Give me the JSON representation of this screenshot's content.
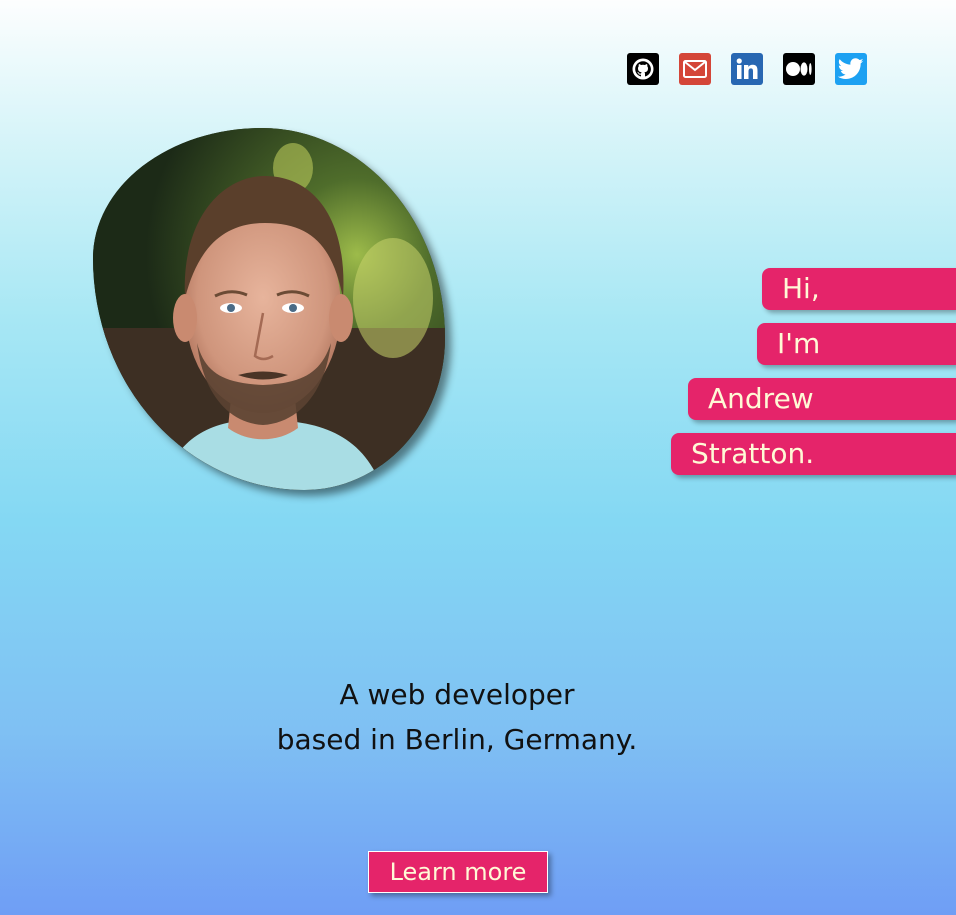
{
  "socials": [
    {
      "name": "GitHub",
      "icon": "github-icon",
      "color": "#000000"
    },
    {
      "name": "Email",
      "icon": "mail-icon",
      "color": "#d44638"
    },
    {
      "name": "LinkedIn",
      "icon": "linkedin-icon",
      "color": "#2867b2"
    },
    {
      "name": "Medium",
      "icon": "medium-icon",
      "color": "#000000"
    },
    {
      "name": "Twitter",
      "icon": "twitter-icon",
      "color": "#1da1f2"
    }
  ],
  "hero": {
    "greeting": [
      "Hi,",
      "I'm",
      "Andrew",
      "Stratton."
    ],
    "tagline_line1": "A web developer",
    "tagline_line2": "based in Berlin, Germany.",
    "cta_label": "Learn more"
  },
  "colors": {
    "accent": "#e5246a",
    "accent_text": "#fff9d6",
    "gradient_top": "#fdfefe",
    "gradient_bottom": "#6f9ef5"
  }
}
